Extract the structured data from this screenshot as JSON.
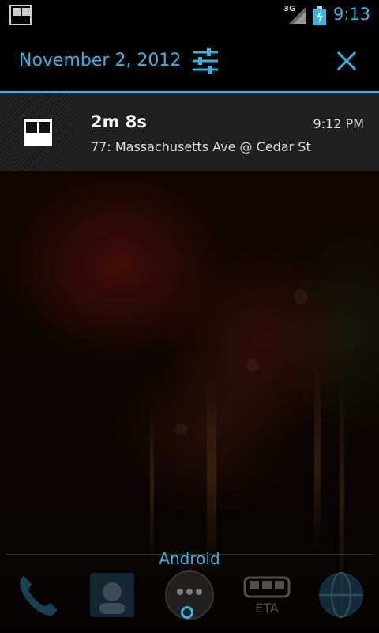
{
  "status_bar": {
    "network_type": "3G",
    "clock": "9:13",
    "icons": [
      "notification-app-icon",
      "signal-icon",
      "battery-charging-icon"
    ]
  },
  "notification_header": {
    "date": "November 2, 2012",
    "settings_icon": "settings-sliders-icon",
    "clear_icon": "clear-all-icon"
  },
  "notifications": [
    {
      "icon": "transit-app-icon",
      "title": "2m 8s",
      "time": "9:12 PM",
      "body": "77: Massachusetts Ave @ Cedar St"
    }
  ],
  "home_screen": {
    "folder_label": "Android",
    "dock": [
      {
        "name": "phone-app-icon"
      },
      {
        "name": "contacts-app-icon"
      },
      {
        "name": "app-drawer-icon"
      },
      {
        "name": "eta-app-icon",
        "label": "ETA"
      },
      {
        "name": "browser-app-icon"
      }
    ]
  },
  "colors": {
    "accent": "#33b5e5",
    "background": "#000000",
    "notification_bg": "#202020"
  }
}
